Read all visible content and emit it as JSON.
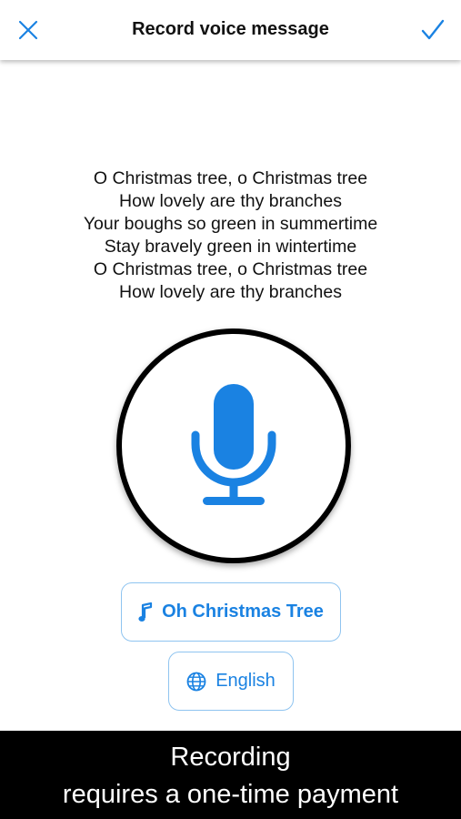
{
  "header": {
    "title": "Record voice message",
    "close_icon": "close-icon",
    "confirm_icon": "checkmark-icon"
  },
  "lyrics": [
    "O Christmas tree, o Christmas tree",
    "How lovely are thy branches",
    "Your boughs so green in summertime",
    "Stay bravely green in wintertime",
    "O Christmas tree, o Christmas tree",
    "How lovely are thy branches"
  ],
  "record": {
    "icon": "microphone-icon"
  },
  "song_button": {
    "icon": "music-note-icon",
    "label": "Oh Christmas Tree"
  },
  "language_button": {
    "icon": "globe-icon",
    "label": "English"
  },
  "banner": {
    "line1": "Recording",
    "line2": "requires a one-time payment"
  },
  "colors": {
    "accent": "#1a82e2",
    "button_border": "#8fc4f0",
    "banner_bg": "#000000",
    "banner_text": "#ffffff"
  }
}
